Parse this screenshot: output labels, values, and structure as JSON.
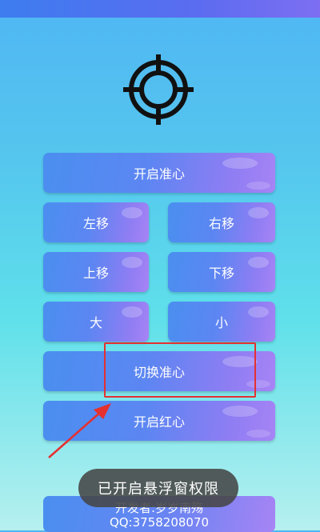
{
  "buttons": {
    "open_crosshair": "开启准心",
    "move_left": "左移",
    "move_right": "右移",
    "move_up": "上移",
    "move_down": "下移",
    "bigger": "大",
    "smaller": "小",
    "switch_crosshair": "切换准心",
    "open_red_dot": "开启红心"
  },
  "developer": {
    "line1": "开发者:岁岁南殇",
    "line2": "QQ:3758208070"
  },
  "toast": "已开启悬浮窗权限",
  "colors": {
    "annotation": "#e53030",
    "icon": "#111111"
  }
}
